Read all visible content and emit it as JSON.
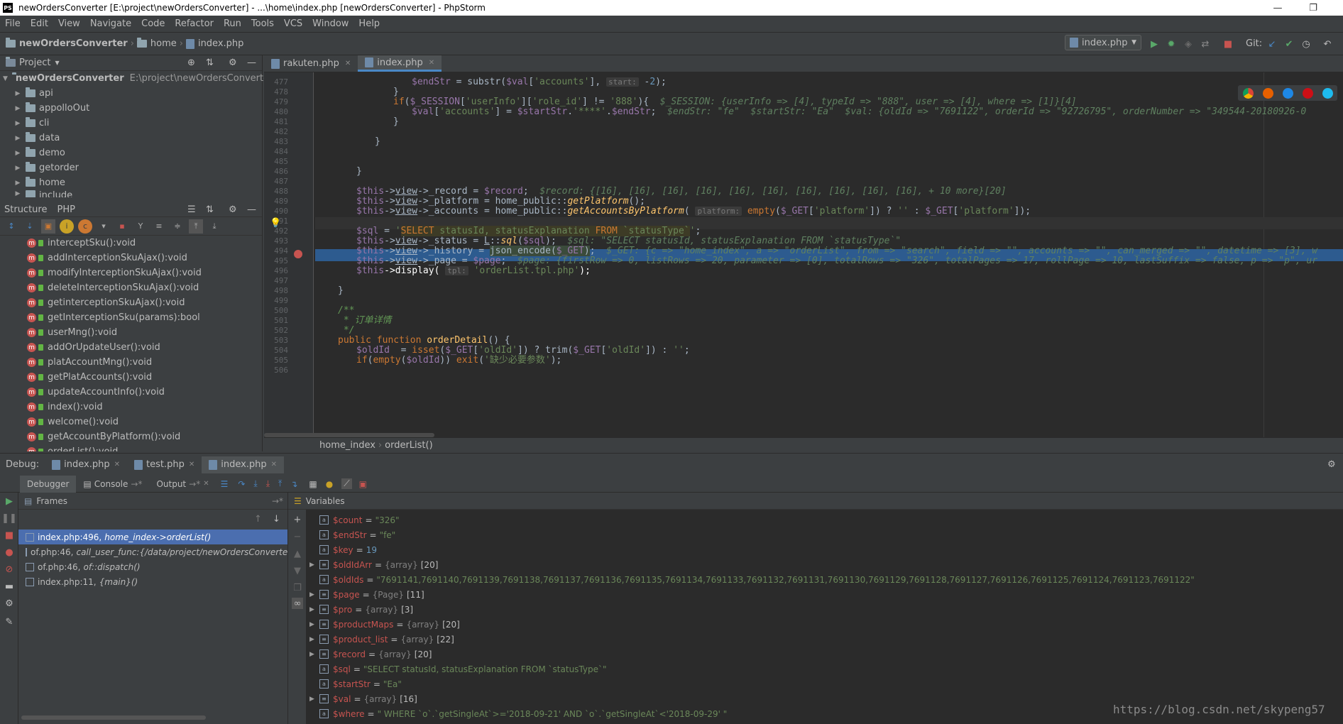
{
  "window": {
    "title": "newOrdersConverter [E:\\project\\newOrdersConverter] - ...\\home\\index.php [newOrdersConverter] - PhpStorm",
    "logo": "PS"
  },
  "menu": [
    "File",
    "Edit",
    "View",
    "Navigate",
    "Code",
    "Refactor",
    "Run",
    "Tools",
    "VCS",
    "Window",
    "Help"
  ],
  "breadcrumbs": [
    "newOrdersConverter",
    "home",
    "index.php"
  ],
  "run_config": "index.php",
  "vcs_label": "Git:",
  "project_panel": {
    "title": "Project",
    "root_name": "newOrdersConverter",
    "root_path": "E:\\project\\newOrdersConverter",
    "folders": [
      "api",
      "appolloOut",
      "cli",
      "data",
      "demo",
      "getorder",
      "home",
      "include"
    ]
  },
  "structure_panel": {
    "tabs": [
      "Structure",
      "PHP"
    ],
    "methods": [
      "interceptSku():void",
      "addInterceptionSkuAjax():void",
      "modifyInterceptionSkuAjax():void",
      "deleteInterceptionSkuAjax():void",
      "getinterceptionSkuAjax():void",
      "getInterceptionSku(params):bool",
      "userMng():void",
      "addOrUpdateUser():void",
      "platAccountMng():void",
      "getPlatAccounts():void",
      "updateAccountInfo():void",
      "index():void",
      "welcome():void",
      "getAccountByPlatform():void",
      "orderList():void"
    ]
  },
  "editor": {
    "tabs": [
      "rakuten.php",
      "index.php"
    ],
    "active_tab": "index.php",
    "line_numbers": [
      "477",
      "478",
      "479",
      "480",
      "481",
      "482",
      "483",
      "484",
      "485",
      "486",
      "487",
      "488",
      "489",
      "490",
      "491",
      "492",
      "493",
      "494",
      "495",
      "496",
      "497",
      "498",
      "499",
      "500",
      "501",
      "502",
      "503",
      "504",
      "505",
      "506"
    ],
    "hints": {
      "start": "start:",
      "platform": "platform:",
      "tpl": "tpl:"
    },
    "inline_values": {
      "l479": "$_SESSION: {userInfo => [4], typeId => \"888\", user => [4], where => [1]}[4]",
      "l480": "$endStr: \"fe\"  $startStr: \"Ea\"  $val: {oldId => \"7691122\", orderId => \"92726795\", orderNumber => \"349544-20180926-0",
      "l488": "$record: {[16], [16], [16], [16], [16], [16], [16], [16], [16], [16], + 10 more}[20]",
      "l493": "$sql: \"SELECT statusId, statusExplanation FROM `statusType`\"",
      "l494": "$_GET: {c => \"home_index\", a => \"orderList\", from => \"search\", field => \"\", accounts => \"\", can_merged => \"\", datetime => [3], w",
      "l495": "$page: {firstRow => 0, listRows => 20, parameter => [0], totalRows => \"326\", totalPages => 17, rollPage => 10, lastSuffix => false, p => \"p\", ur"
    },
    "comment_cn": "订单详情",
    "missing_param_cn": "缺少必要参数",
    "status_crumb": [
      "home_index",
      "orderList()"
    ]
  },
  "debug": {
    "label": "Debug:",
    "sessions": [
      "index.php",
      "test.php",
      "index.php"
    ],
    "tabs": [
      "Debugger",
      "Console",
      "Output"
    ],
    "frames_title": "Frames",
    "variables_title": "Variables",
    "frames": [
      {
        "loc": "index.php:496,",
        "fn": "home_index->orderList()"
      },
      {
        "loc": "of.php:46,",
        "fn": "call_user_func:{/data/project/newOrdersConverter/"
      },
      {
        "loc": "of.php:46,",
        "fn": "of::dispatch()"
      },
      {
        "loc": "index.php:11,",
        "fn": "{main}()"
      }
    ],
    "variables": [
      {
        "name": "$count",
        "type": "",
        "value": "\"326\"",
        "expandable": false
      },
      {
        "name": "$endStr",
        "type": "",
        "value": "\"fe\"",
        "expandable": false
      },
      {
        "name": "$key",
        "type": "",
        "value": "19",
        "expandable": false
      },
      {
        "name": "$oldIdArr",
        "type": "{array}",
        "value": "[20]",
        "expandable": true
      },
      {
        "name": "$oldIds",
        "type": "",
        "value": "\"7691141,7691140,7691139,7691138,7691137,7691136,7691135,7691134,7691133,7691132,7691131,7691130,7691129,7691128,7691127,7691126,7691125,7691124,7691123,7691122\"",
        "expandable": false
      },
      {
        "name": "$page",
        "type": "{Page}",
        "value": "[11]",
        "expandable": true
      },
      {
        "name": "$pro",
        "type": "{array}",
        "value": "[3]",
        "expandable": true
      },
      {
        "name": "$productMaps",
        "type": "{array}",
        "value": "[20]",
        "expandable": true
      },
      {
        "name": "$product_list",
        "type": "{array}",
        "value": "[22]",
        "expandable": true
      },
      {
        "name": "$record",
        "type": "{array}",
        "value": "[20]",
        "expandable": true
      },
      {
        "name": "$sql",
        "type": "",
        "value": "\"SELECT statusId, statusExplanation FROM `statusType`\"",
        "expandable": false
      },
      {
        "name": "$startStr",
        "type": "",
        "value": "\"Ea\"",
        "expandable": false
      },
      {
        "name": "$val",
        "type": "{array}",
        "value": "[16]",
        "expandable": true
      },
      {
        "name": "$where",
        "type": "",
        "value": "\" WHERE `o`.`getSingleAt`>='2018-09-21' AND `o`.`getSingleAt`<'2018-09-29' \"",
        "expandable": false
      }
    ]
  },
  "watermark": "https://blog.csdn.net/skypeng57",
  "colors": {
    "accent": "#4a88c7",
    "exec_line": "#2d5b8f",
    "breakpoint": "#c75450",
    "selected_frame": "#4b6eaf"
  }
}
